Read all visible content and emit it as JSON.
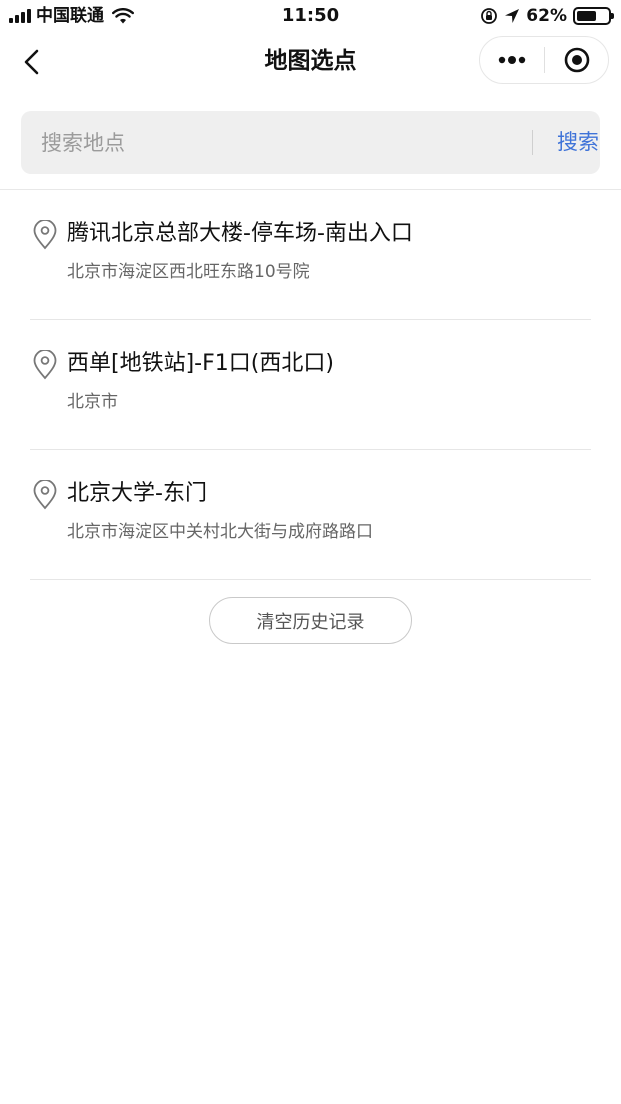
{
  "status_bar": {
    "carrier": "中国联通",
    "time": "11:50",
    "battery_percent": "62%",
    "battery_level": 0.62
  },
  "nav": {
    "title": "地图选点"
  },
  "search": {
    "placeholder": "搜索地点",
    "value": "",
    "button_label": "搜索"
  },
  "history": [
    {
      "name": "腾讯北京总部大楼-停车场-南出入口",
      "address": "北京市海淀区西北旺东路10号院"
    },
    {
      "name": "西单[地铁站]-F1口(西北口)",
      "address": "北京市"
    },
    {
      "name": "北京大学-东门",
      "address": "北京市海淀区中关村北大街与成府路路口"
    }
  ],
  "clear_history_label": "清空历史记录",
  "colors": {
    "accent": "#3f73d8",
    "search_bg": "#efefef",
    "secondary_text": "#666666"
  }
}
